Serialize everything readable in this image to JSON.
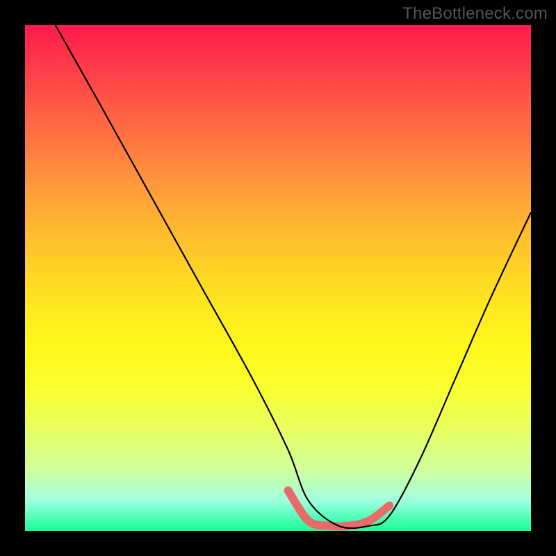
{
  "watermark": "TheBottleneck.com",
  "chart_data": {
    "type": "line",
    "title": "",
    "xlabel": "",
    "ylabel": "",
    "xlim": [
      0,
      100
    ],
    "ylim": [
      0,
      100
    ],
    "grid": false,
    "series": [
      {
        "name": "black-curve",
        "color": "#000000",
        "x": [
          6,
          15,
          25,
          35,
          45,
          52,
          56,
          62,
          68,
          72,
          78,
          85,
          92,
          100
        ],
        "y": [
          100,
          84,
          66,
          48,
          30,
          16,
          6,
          1,
          1,
          3,
          14,
          30,
          46,
          63
        ]
      },
      {
        "name": "pink-highlight",
        "color": "#e96a6a",
        "x": [
          52,
          56,
          60,
          64,
          68,
          72
        ],
        "y": [
          8,
          2,
          1,
          1,
          2,
          5
        ]
      }
    ],
    "gradient": {
      "orientation": "vertical",
      "stops": [
        {
          "pos": 0,
          "color": "#ff1a4a"
        },
        {
          "pos": 50,
          "color": "#ffd226"
        },
        {
          "pos": 75,
          "color": "#f8ff30"
        },
        {
          "pos": 100,
          "color": "#20ff90"
        }
      ]
    }
  }
}
